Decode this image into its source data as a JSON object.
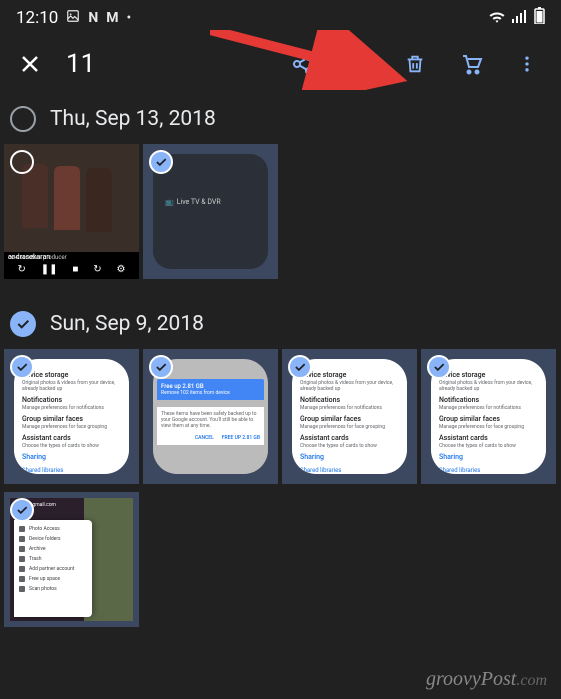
{
  "status_bar": {
    "time": "12:10",
    "icons": [
      "image-icon",
      "netflix-icon",
      "gmail-icon",
      "dot-icon"
    ],
    "right_icons": [
      "wifi-icon",
      "signal-icon",
      "battery-icon"
    ]
  },
  "top_bar": {
    "close": "×",
    "selection_count": "11",
    "actions": [
      "share-icon",
      "add-icon",
      "delete-icon",
      "cart-icon",
      "overflow-icon"
    ],
    "accent_color": "#8ab4f8"
  },
  "sections": [
    {
      "checked": false,
      "title": "Thu, Sep 13, 2018",
      "items": [
        {
          "type": "video",
          "checked": true,
          "credit": "andrasekaran"
        },
        {
          "type": "tv",
          "checked": true,
          "label": "Live TV & DVR"
        }
      ]
    },
    {
      "checked": true,
      "title": "Sun, Sep 9, 2018",
      "items": [
        {
          "type": "settings",
          "checked": true
        },
        {
          "type": "freeup",
          "checked": true,
          "title": "Free up 2.81 GB",
          "subtitle": "Remove 102 items from device",
          "body": "These items have been safely backed up to your Google account. You'll still be able to view them at any time.",
          "cancel": "CANCEL",
          "action": "FREE UP 2.81 GB"
        },
        {
          "type": "settings",
          "checked": true
        },
        {
          "type": "settings",
          "checked": true
        },
        {
          "type": "menu",
          "checked": true,
          "menu_items": [
            "Photo Access",
            "Device folders",
            "Archive",
            "Trash",
            "Add partner account",
            "Free up space",
            "Scan photos"
          ]
        }
      ]
    }
  ],
  "settings_card": {
    "heading1": "Device storage",
    "sub0": "Original photos & videos from your device, already backed up",
    "heading2": "Notifications",
    "sub1": "Manage preferences for notifications",
    "heading3": "Group similar faces",
    "sub2": "Manage preferences for face grouping",
    "heading4": "Assistant cards",
    "sub3": "Choose the types of cards to show",
    "heading5": "Sharing",
    "blue": "Shared libraries"
  },
  "watermark": {
    "text": "groovyPost",
    "suffix": ".com"
  }
}
